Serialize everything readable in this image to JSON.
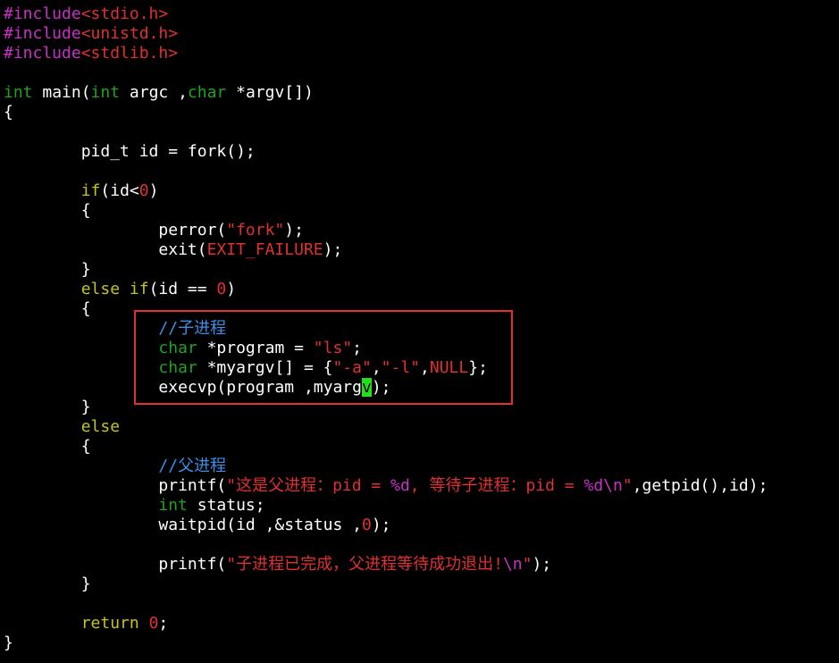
{
  "colors": {
    "background": "#000000",
    "preprocessor": "#c930c7",
    "string": "#e0302f",
    "type": "#1da41d",
    "keyword": "#c4c41a",
    "comment": "#3d8ee6",
    "cursor": "#22e11a",
    "highlight_box": "#e0302f"
  },
  "code": {
    "l1": [
      "#include",
      "<stdio.h>"
    ],
    "l2": [
      "#include",
      "<unistd.h>"
    ],
    "l3": [
      "#include",
      "<stdlib.h>"
    ],
    "l5": [
      "int",
      " main(",
      "int",
      " argc ,",
      "char",
      " *argv[])"
    ],
    "l6": [
      "{"
    ],
    "l8": [
      "        pid_t id = fork();"
    ],
    "l10": [
      "        ",
      "if",
      "(id<",
      "0",
      ")"
    ],
    "l11": [
      "        {"
    ],
    "l12": [
      "                perror(",
      "\"fork\"",
      ");"
    ],
    "l13": [
      "                exit(",
      "EXIT_FAILURE",
      ");"
    ],
    "l14": [
      "        }"
    ],
    "l15": [
      "        ",
      "else if",
      "(id == ",
      "0",
      ")"
    ],
    "l16": [
      "        {"
    ],
    "l17": [
      "                ",
      "//子进程"
    ],
    "l18": [
      "                ",
      "char",
      " *program = ",
      "\"ls\"",
      ";"
    ],
    "l19": [
      "                ",
      "char",
      " *myargv[] = {",
      "\"-a\"",
      ",",
      "\"-l\"",
      ",",
      "NULL",
      "};"
    ],
    "l20": [
      "                execvp(program ,myarg",
      "v",
      ");"
    ],
    "l21": [
      "        }"
    ],
    "l22": [
      "        ",
      "else"
    ],
    "l23": [
      "        {"
    ],
    "l24": [
      "                ",
      "//父进程"
    ],
    "l25": [
      "                printf(",
      "\"这是父进程：pid = ",
      "%d",
      ", 等待子进程：pid = ",
      "%d\\n",
      "\"",
      ",getpid(),id);"
    ],
    "l26": [
      "                ",
      "int",
      " status;"
    ],
    "l27": [
      "                waitpid(id ,&status ,",
      "0",
      ");"
    ],
    "l29": [
      "                printf(",
      "\"子进程已完成，父进程等待成功退出!",
      "\\n",
      "\"",
      ");"
    ],
    "l30": [
      "        }"
    ],
    "l32": [
      "        ",
      "return",
      " ",
      "0",
      ";"
    ],
    "l33": [
      "}"
    ]
  }
}
